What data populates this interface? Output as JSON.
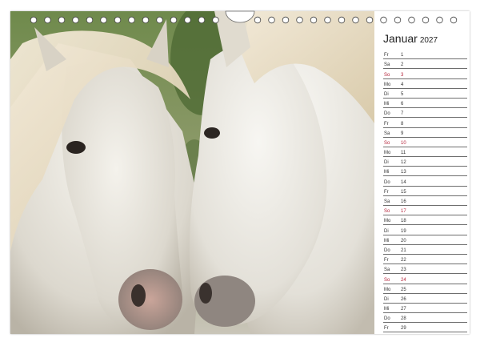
{
  "calendar": {
    "month": "Januar",
    "year": "2027",
    "sunday_color": "#b5243a",
    "days": [
      {
        "dow": "Fr",
        "day": "1"
      },
      {
        "dow": "Sa",
        "day": "2"
      },
      {
        "dow": "So",
        "day": "3"
      },
      {
        "dow": "Mo",
        "day": "4"
      },
      {
        "dow": "Di",
        "day": "5"
      },
      {
        "dow": "Mi",
        "day": "6"
      },
      {
        "dow": "Do",
        "day": "7"
      },
      {
        "dow": "Fr",
        "day": "8"
      },
      {
        "dow": "Sa",
        "day": "9"
      },
      {
        "dow": "So",
        "day": "10"
      },
      {
        "dow": "Mo",
        "day": "11"
      },
      {
        "dow": "Di",
        "day": "12"
      },
      {
        "dow": "Mi",
        "day": "13"
      },
      {
        "dow": "Do",
        "day": "14"
      },
      {
        "dow": "Fr",
        "day": "15"
      },
      {
        "dow": "Sa",
        "day": "16"
      },
      {
        "dow": "So",
        "day": "17"
      },
      {
        "dow": "Mo",
        "day": "18"
      },
      {
        "dow": "Di",
        "day": "19"
      },
      {
        "dow": "Mi",
        "day": "20"
      },
      {
        "dow": "Do",
        "day": "21"
      },
      {
        "dow": "Fr",
        "day": "22"
      },
      {
        "dow": "Sa",
        "day": "23"
      },
      {
        "dow": "So",
        "day": "24"
      },
      {
        "dow": "Mo",
        "day": "25"
      },
      {
        "dow": "Di",
        "day": "26"
      },
      {
        "dow": "Mi",
        "day": "27"
      },
      {
        "dow": "Do",
        "day": "28"
      },
      {
        "dow": "Fr",
        "day": "29"
      },
      {
        "dow": "Sa",
        "day": "30"
      },
      {
        "dow": "So",
        "day": "31"
      }
    ]
  },
  "photo": {
    "subject": "two white horses"
  }
}
